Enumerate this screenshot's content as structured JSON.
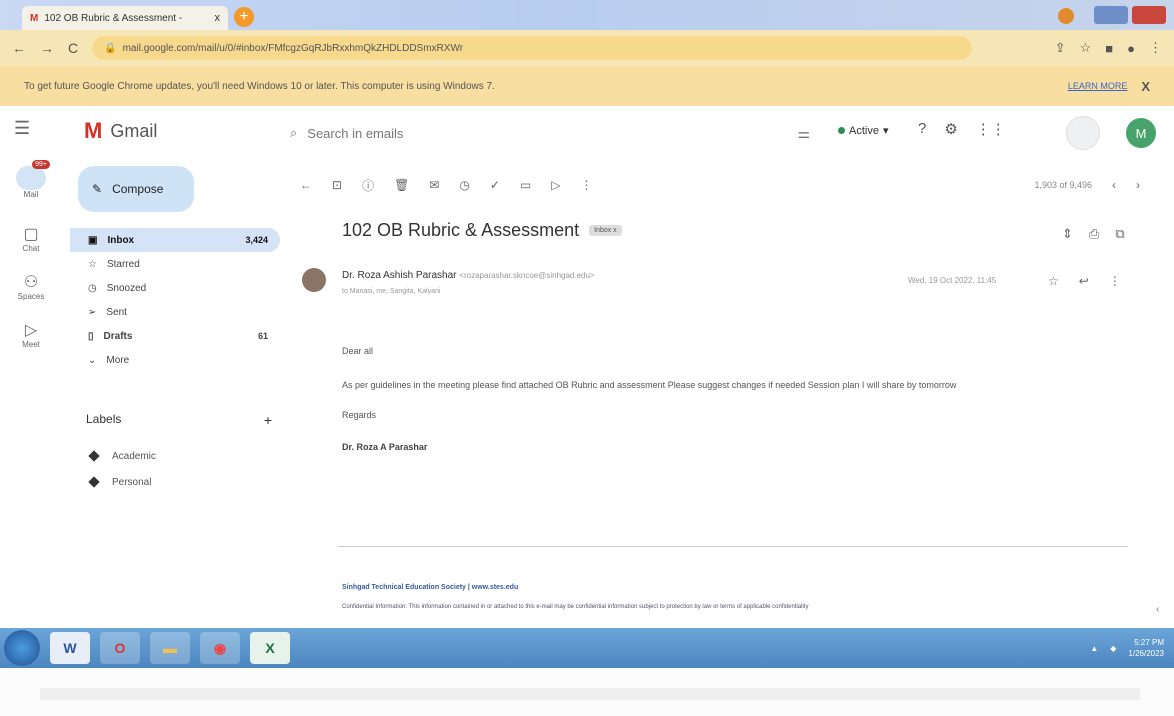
{
  "browser": {
    "tab_title": "102 OB Rubric & Assessment -",
    "tab_close": "x",
    "new_tab": "+",
    "url": "mail.google.com/mail/u/0/#inbox/FMfcgzGqRJbRxxhmQkZHDLDDSmxRXWr",
    "update_message": "To get future Google Chrome updates, you'll need Windows 10 or later. This computer is using Windows 7.",
    "learn_more": "LEARN MORE",
    "infobar_close": "X"
  },
  "gmail": {
    "app_name": "Gmail",
    "search_placeholder": "Search in emails",
    "status": "Active",
    "compose": "Compose",
    "rail": [
      {
        "label": "Mail",
        "badge": "99+"
      },
      {
        "label": "Chat"
      },
      {
        "label": "Spaces"
      },
      {
        "label": "Meet"
      }
    ],
    "nav": [
      {
        "label": "Inbox",
        "count": "3,424"
      },
      {
        "label": "Starred"
      },
      {
        "label": "Snoozed"
      },
      {
        "label": "Sent"
      },
      {
        "label": "Drafts",
        "count": "61"
      },
      {
        "label": "More"
      }
    ],
    "labels_heading": "Labels",
    "labels_add": "+",
    "labels": [
      {
        "name": "Academic"
      },
      {
        "name": "Personal"
      }
    ],
    "pager": "1,903 of 9,496"
  },
  "email": {
    "subject": "102 OB Rubric & Assessment",
    "inbox_chip": "Inbox x",
    "sender_name": "Dr. Roza Ashish Parashar",
    "sender_email": "<rozaparashar.skncoe@sinhgad.edu>",
    "recipients": "to Manasi, me, Sangita, Kalyani",
    "date": "Wed, 19 Oct 2022, 11:45",
    "greeting": "Dear all",
    "body": "As per guidelines in the meeting please find attached OB Rubric and assessment Please suggest changes if needed Session plan I will share by tomorrow",
    "regards": "Regards",
    "signature": "Dr. Roza A Parashar",
    "org_line": "Sinhgad Technical Education Society | www.stes.edu",
    "confidential": "Confidential Information: This information contained in or attached to this e-mail may be confidential information subject to protection by law or terms of applicable confidentiality"
  },
  "taskbar": {
    "time": "5:27 PM",
    "date": "1/26/2023"
  }
}
